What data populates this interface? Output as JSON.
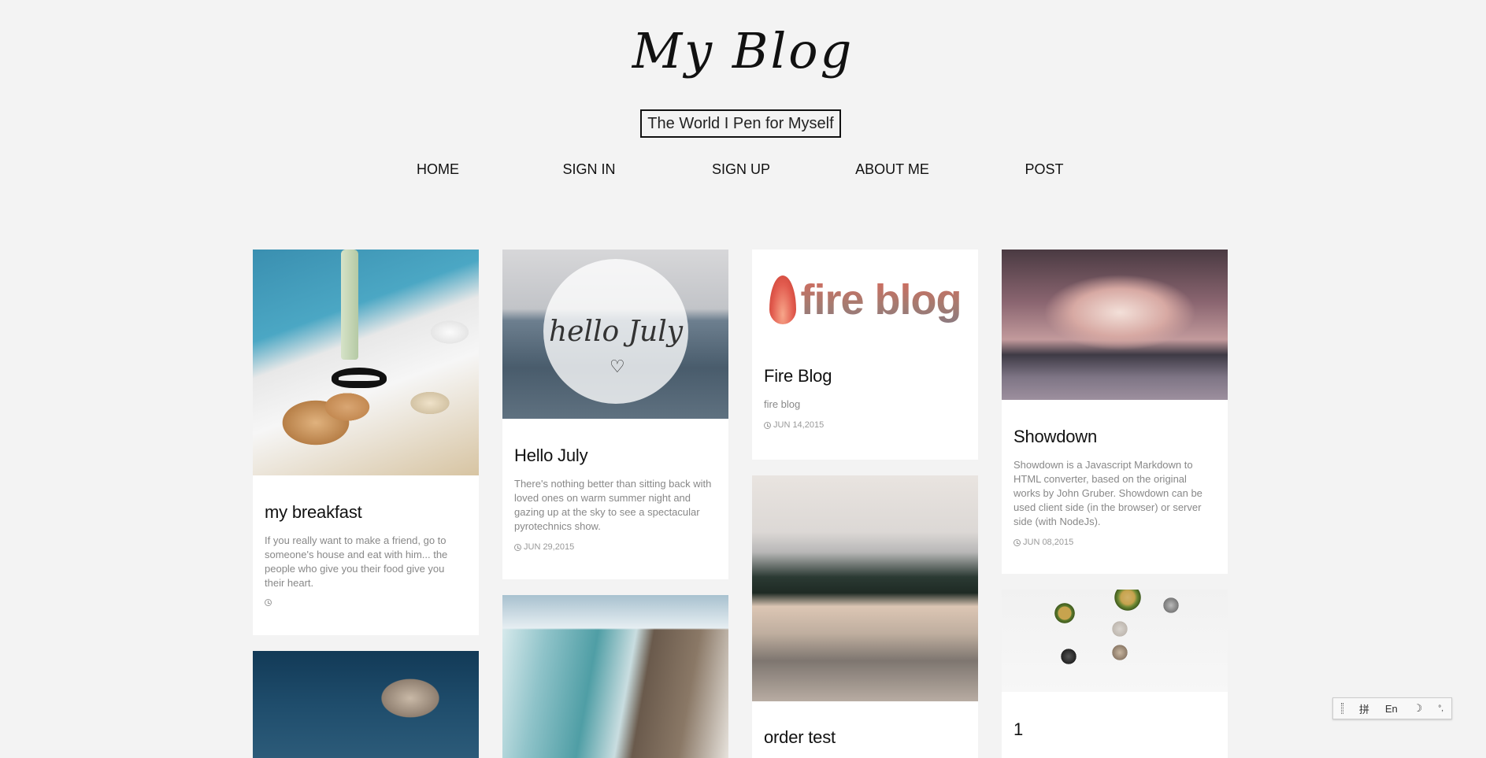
{
  "header": {
    "title": "My Blog",
    "tagline": "The World I Pen for Myself"
  },
  "nav": [
    "HOME",
    "SIGN IN",
    "SIGN UP",
    "ABOUT ME",
    "POST"
  ],
  "posts": [
    {
      "title": "my breakfast",
      "excerpt": "If you really want to make a friend, go to someone's house and eat with him... the people who give you their food give you their heart.",
      "date": ""
    },
    {
      "title": "Hello July",
      "image_text": "hello July",
      "excerpt": "There's nothing better than sitting back with loved ones on warm summer night and gazing up at the sky to see a spectacular pyrotechnics show.",
      "date": "JUN 29,2015"
    },
    {
      "title": "Fire Blog",
      "image_text": "fire blog",
      "excerpt": "fire blog",
      "date": "JUN 14,2015"
    },
    {
      "title": "Showdown",
      "excerpt": "Showdown is a Javascript Markdown to HTML converter, based on the original works by John Gruber. Showdown can be used client side (in the browser) or server side (with NodeJs).",
      "date": "JUN 08,2015"
    },
    {
      "title": "order test"
    },
    {
      "title": "1"
    }
  ],
  "ime_toolbar": {
    "items": [
      "拼",
      "En"
    ]
  },
  "colors": {
    "background": "#f3f3f3",
    "card": "#ffffff",
    "text_muted": "#888888"
  }
}
